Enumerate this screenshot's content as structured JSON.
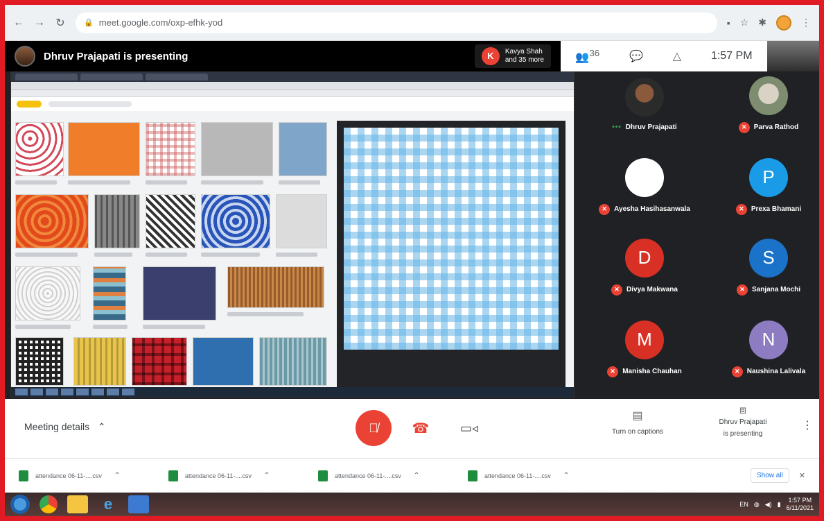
{
  "browser": {
    "url": "meet.google.com/oxp-efhk-yod"
  },
  "presenter_bar": {
    "title": "Dhruv Prajapati is presenting",
    "others_initial": "K",
    "others_line1": "Kavya Shah",
    "others_line2": "and 35 more"
  },
  "meet_header": {
    "participants_count": "36",
    "time": "1:57 PM"
  },
  "participants": [
    {
      "name": "Dhruv Prajapati",
      "initial": "",
      "color": "",
      "style": "photo1",
      "muted": false
    },
    {
      "name": "Parva Rathod",
      "initial": "",
      "color": "",
      "style": "photo2",
      "muted": true
    },
    {
      "name": "Ayesha Hasihasanwala",
      "initial": "",
      "color": "#ffffff",
      "style": "white",
      "muted": true
    },
    {
      "name": "Prexa Bhamani",
      "initial": "P",
      "color": "#1a9be8",
      "style": "letter",
      "muted": true
    },
    {
      "name": "Divya Makwana",
      "initial": "D",
      "color": "#d93025",
      "style": "letter",
      "muted": true
    },
    {
      "name": "Sanjana Mochi",
      "initial": "S",
      "color": "#1a73c8",
      "style": "letter",
      "muted": true
    },
    {
      "name": "Manisha Chauhan",
      "initial": "M",
      "color": "#d93025",
      "style": "letter",
      "muted": true
    },
    {
      "name": "Naushina Lalivala",
      "initial": "N",
      "color": "#8e7cc3",
      "style": "letter",
      "muted": true
    }
  ],
  "controls": {
    "meeting_details": "Meeting details",
    "captions": "Turn on captions",
    "presenting_line1": "Dhruv Prajapati",
    "presenting_line2": "is presenting"
  },
  "downloads": {
    "items": [
      "attendance 06-11-....csv",
      "attendance 06-11-....csv",
      "attendance 06-11-....csv",
      "attendance 06-11-....csv"
    ],
    "show_all": "Show all"
  },
  "taskbar": {
    "lang": "EN",
    "time": "1:57 PM",
    "date": "6/11/2021"
  },
  "colors": {
    "frame": "#e01b24",
    "meet_red": "#ea4335",
    "dark_bg": "#202124"
  }
}
